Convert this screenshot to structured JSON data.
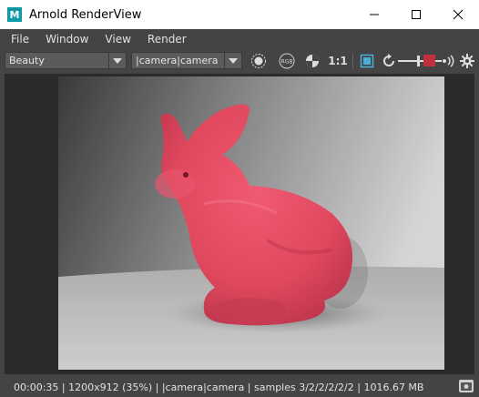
{
  "window": {
    "app_icon_letter": "M",
    "title": "Arnold RenderView"
  },
  "menu": {
    "items": [
      {
        "label": "File"
      },
      {
        "label": "Window"
      },
      {
        "label": "View"
      },
      {
        "label": "Render"
      }
    ]
  },
  "toolbar": {
    "aov_value": "Beauty",
    "camera_value": "|camera|camera",
    "rgb_label": "RGB",
    "ratio_label": "1:1",
    "icons": [
      "region-select-icon",
      "display-rgb-icon",
      "exposure-icon",
      "crop-region-icon",
      "refresh-icon",
      "stop-render-icon",
      "ipr-icon",
      "settings-gear-icon"
    ],
    "stop_color": "#c0303f"
  },
  "render": {
    "subject": "pink bunny",
    "subject_color": "#e0485e"
  },
  "status": {
    "text": "00:00:35 | 1200x912 (35%) | |camera|camera  | samples 3/2/2/2/2/2 | 1016.67 MB"
  }
}
